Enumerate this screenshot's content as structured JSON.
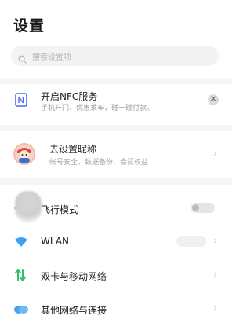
{
  "page": {
    "title": "设置"
  },
  "search": {
    "placeholder": "搜索设置项"
  },
  "nfc": {
    "title": "开启NFC服务",
    "subtitle": "手机开门、优惠乘车，碰一碰付款。"
  },
  "account": {
    "title": "去设置昵称",
    "subtitle": "帐号安全、数据备份、会员权益"
  },
  "items": [
    {
      "label": "飞行模式",
      "icon": "airplane-icon",
      "accent": "#f5a623",
      "control": "toggle",
      "on": false
    },
    {
      "label": "WLAN",
      "icon": "wifi-icon",
      "accent": "#3ba0f2",
      "control": "chevron"
    },
    {
      "label": "双卡与移动网络",
      "icon": "sim-arrows-icon",
      "accent": "#2bc16d",
      "control": "chevron"
    },
    {
      "label": "其他网络与连接",
      "icon": "cloud-link-icon",
      "accent": "#4aa3ee",
      "control": "chevron"
    }
  ],
  "colors": {
    "nfc_icon": "#4a6cf7",
    "divider": "#f6f6f6"
  }
}
